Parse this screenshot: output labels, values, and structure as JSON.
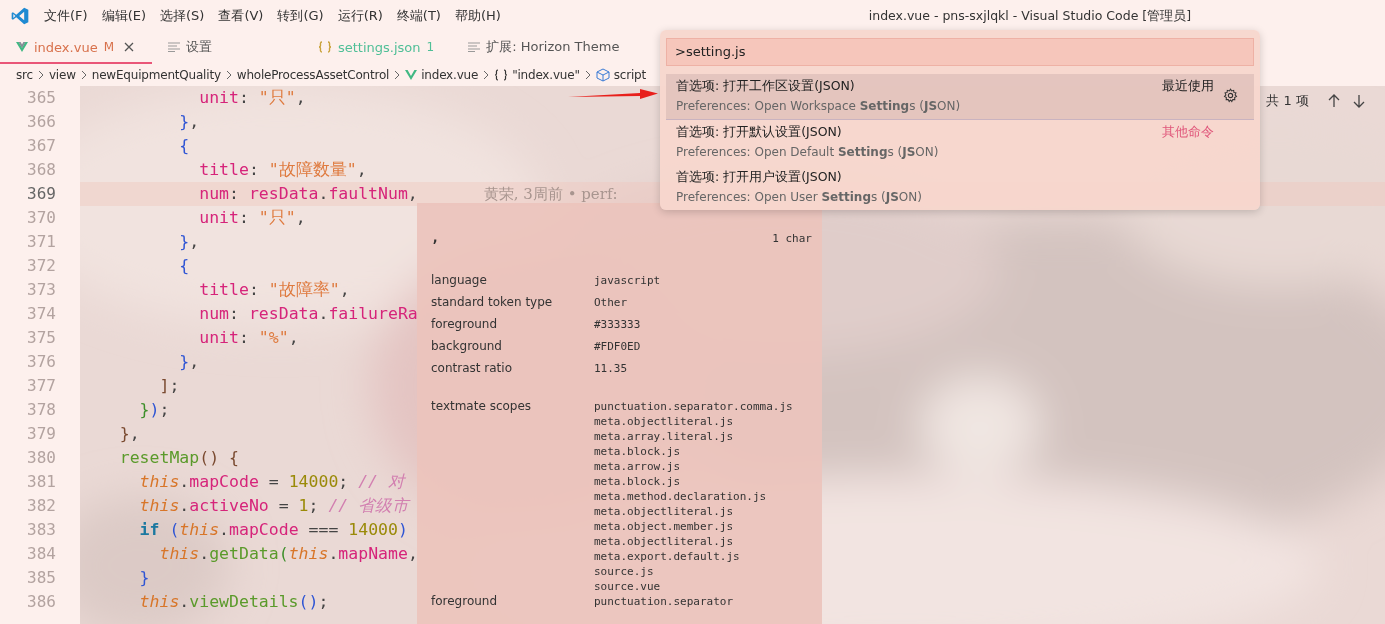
{
  "menu": [
    "文件(F)",
    "编辑(E)",
    "选择(S)",
    "查看(V)",
    "转到(G)",
    "运行(R)",
    "终端(T)",
    "帮助(H)"
  ],
  "window": {
    "title": "index.vue - pns-sxjlqkl - Visual Studio Code [管理员]"
  },
  "tabs": [
    {
      "label": "index.vue",
      "kind": "vue",
      "badge": "M",
      "modified": true,
      "problems": false,
      "selected": true
    },
    {
      "label": "设置",
      "kind": "lines",
      "modified": false,
      "problems": false,
      "selected": false
    },
    {
      "label": "settings.json",
      "kind": "braces",
      "badge": "1",
      "modified": false,
      "problems": true,
      "selected": false
    },
    {
      "label": "扩展: Horizon Theme",
      "kind": "lines",
      "modified": false,
      "problems": false,
      "selected": false
    }
  ],
  "breadcrumb": [
    {
      "label": "src"
    },
    {
      "label": "view"
    },
    {
      "label": "newEquipmentQuality"
    },
    {
      "label": "wholeProcessAssetControl"
    },
    {
      "label": "index.vue",
      "kind": "vue"
    },
    {
      "label": "\"index.vue\"",
      "kind": "braces"
    },
    {
      "label": "script",
      "kind": "cube"
    }
  ],
  "find_widget": {
    "count": "共 1 项"
  },
  "code": {
    "lines": [
      {
        "number": "365",
        "tokens": [
          {
            "kind": "prop",
            "t": "            unit"
          },
          {
            "kind": "punct",
            "t": ": "
          },
          {
            "kind": "str",
            "t": "\"只\""
          },
          {
            "kind": "punct",
            "t": ","
          }
        ]
      },
      {
        "number": "366",
        "tokens": [
          {
            "kind": "b1",
            "t": "          }"
          },
          {
            "kind": "punct",
            "t": ","
          }
        ]
      },
      {
        "number": "367",
        "tokens": [
          {
            "kind": "b1",
            "t": "          {"
          }
        ]
      },
      {
        "number": "368",
        "tokens": [
          {
            "kind": "prop",
            "t": "            title"
          },
          {
            "kind": "punct",
            "t": ": "
          },
          {
            "kind": "str",
            "t": "\"故障数量\""
          },
          {
            "kind": "punct",
            "t": ","
          }
        ]
      },
      {
        "number": "369",
        "current": true,
        "tokens": [
          {
            "kind": "prop",
            "t": "            num"
          },
          {
            "kind": "punct",
            "t": ": "
          },
          {
            "kind": "prop",
            "t": "resData"
          },
          {
            "kind": "punct",
            "t": "."
          },
          {
            "kind": "prop",
            "t": "faultNum"
          },
          {
            "kind": "punct",
            "t": ","
          }
        ],
        "blame": "黄荣, 3周前 • perf:"
      },
      {
        "number": "370",
        "tokens": [
          {
            "kind": "prop",
            "t": "            unit"
          },
          {
            "kind": "punct",
            "t": ": "
          },
          {
            "kind": "str",
            "t": "\"只\""
          },
          {
            "kind": "punct",
            "t": ","
          }
        ]
      },
      {
        "number": "371",
        "tokens": [
          {
            "kind": "b1",
            "t": "          }"
          },
          {
            "kind": "punct",
            "t": ","
          }
        ]
      },
      {
        "number": "372",
        "tokens": [
          {
            "kind": "b1",
            "t": "          {"
          }
        ]
      },
      {
        "number": "373",
        "tokens": [
          {
            "kind": "prop",
            "t": "            title"
          },
          {
            "kind": "punct",
            "t": ": "
          },
          {
            "kind": "str",
            "t": "\"故障率\""
          },
          {
            "kind": "punct",
            "t": ","
          }
        ]
      },
      {
        "number": "374",
        "tokens": [
          {
            "kind": "prop",
            "t": "            num"
          },
          {
            "kind": "punct",
            "t": ": "
          },
          {
            "kind": "prop",
            "t": "resData"
          },
          {
            "kind": "punct",
            "t": "."
          },
          {
            "kind": "prop",
            "t": "failureRa"
          }
        ]
      },
      {
        "number": "375",
        "tokens": [
          {
            "kind": "prop",
            "t": "            unit"
          },
          {
            "kind": "punct",
            "t": ": "
          },
          {
            "kind": "str",
            "t": "\"%\""
          },
          {
            "kind": "punct",
            "t": ","
          }
        ]
      },
      {
        "number": "376",
        "tokens": [
          {
            "kind": "b1",
            "t": "          }"
          },
          {
            "kind": "punct",
            "t": ","
          }
        ]
      },
      {
        "number": "377",
        "tokens": [
          {
            "kind": "b3",
            "t": "        ]"
          },
          {
            "kind": "punct",
            "t": ";"
          }
        ]
      },
      {
        "number": "378",
        "tokens": [
          {
            "kind": "b2",
            "t": "      }"
          },
          {
            "kind": "b1",
            "t": ")"
          },
          {
            "kind": "punct",
            "t": ";"
          }
        ]
      },
      {
        "number": "379",
        "tokens": [
          {
            "kind": "b3",
            "t": "    }"
          },
          {
            "kind": "punct",
            "t": ","
          }
        ]
      },
      {
        "number": "380",
        "tokens": [
          {
            "kind": "func",
            "t": "    resetMap"
          },
          {
            "kind": "b3",
            "t": "() {"
          }
        ]
      },
      {
        "number": "381",
        "tokens": [
          {
            "kind": "this",
            "t": "      this"
          },
          {
            "kind": "punct",
            "t": "."
          },
          {
            "kind": "prop",
            "t": "mapCode"
          },
          {
            "kind": "punct",
            "t": " = "
          },
          {
            "kind": "num",
            "t": "14000"
          },
          {
            "kind": "punct",
            "t": "; "
          },
          {
            "kind": "comment",
            "t": "// 对"
          }
        ]
      },
      {
        "number": "382",
        "tokens": [
          {
            "kind": "this",
            "t": "      this"
          },
          {
            "kind": "punct",
            "t": "."
          },
          {
            "kind": "prop",
            "t": "activeNo"
          },
          {
            "kind": "punct",
            "t": " = "
          },
          {
            "kind": "num",
            "t": "1"
          },
          {
            "kind": "punct",
            "t": "; "
          },
          {
            "kind": "comment",
            "t": "// 省级市"
          }
        ]
      },
      {
        "number": "383",
        "tokens": [
          {
            "kind": "kw",
            "t": "      if"
          },
          {
            "kind": "b1",
            "t": " ("
          },
          {
            "kind": "this",
            "t": "this"
          },
          {
            "kind": "punct",
            "t": "."
          },
          {
            "kind": "prop",
            "t": "mapCode"
          },
          {
            "kind": "punct",
            "t": " === "
          },
          {
            "kind": "num",
            "t": "14000"
          },
          {
            "kind": "b1",
            "t": ")"
          }
        ]
      },
      {
        "number": "384",
        "tokens": [
          {
            "kind": "this",
            "t": "        this"
          },
          {
            "kind": "punct",
            "t": "."
          },
          {
            "kind": "func",
            "t": "getData"
          },
          {
            "kind": "b2",
            "t": "("
          },
          {
            "kind": "this",
            "t": "this"
          },
          {
            "kind": "punct",
            "t": "."
          },
          {
            "kind": "prop",
            "t": "mapName"
          },
          {
            "kind": "punct",
            "t": ","
          }
        ]
      },
      {
        "number": "385",
        "tokens": [
          {
            "kind": "b1",
            "t": "      }"
          }
        ]
      },
      {
        "number": "386",
        "tokens": [
          {
            "kind": "this",
            "t": "      this"
          },
          {
            "kind": "punct",
            "t": "."
          },
          {
            "kind": "func",
            "t": "viewDetails"
          },
          {
            "kind": "b1",
            "t": "()"
          },
          {
            "kind": "punct",
            "t": ";"
          }
        ]
      }
    ]
  },
  "hover": {
    "token": ",",
    "length": "1 char",
    "rows": [
      {
        "label": "language",
        "value": "javascript"
      },
      {
        "label": "standard token type",
        "value": "Other"
      },
      {
        "label": "foreground",
        "value": "#333333"
      },
      {
        "label": "background",
        "value": "#FDF0ED"
      },
      {
        "label": "contrast ratio",
        "value": "11.35"
      }
    ],
    "scopes": {
      "label": "textmate scopes",
      "values": [
        "punctuation.separator.comma.js",
        "meta.objectliteral.js",
        "meta.array.literal.js",
        "meta.block.js",
        "meta.arrow.js",
        "meta.block.js",
        "meta.method.declaration.js",
        "meta.objectliteral.js",
        "meta.object.member.js",
        "meta.objectliteral.js",
        "meta.export.default.js",
        "source.js",
        "source.vue"
      ]
    },
    "last_row": {
      "label": "foreground",
      "value": "punctuation.separator"
    }
  },
  "palette": {
    "input": ">setting.js",
    "items": [
      {
        "label": "首选项: 打开工作区设置(JSON)",
        "detail": "Preferences: Open Workspace **Setting**s (**JS**ON)",
        "separator": "最近使用",
        "selected": true
      },
      {
        "label": "首选项: 打开默认设置(JSON)",
        "detail": "Preferences: Open Default **Setting**s (**JS**ON)",
        "separator": "其他命令",
        "selected": false
      },
      {
        "label": "首选项: 打开用户设置(JSON)",
        "detail": "Preferences: Open User **Setting**s (**JS**ON)",
        "selected": false
      }
    ]
  }
}
